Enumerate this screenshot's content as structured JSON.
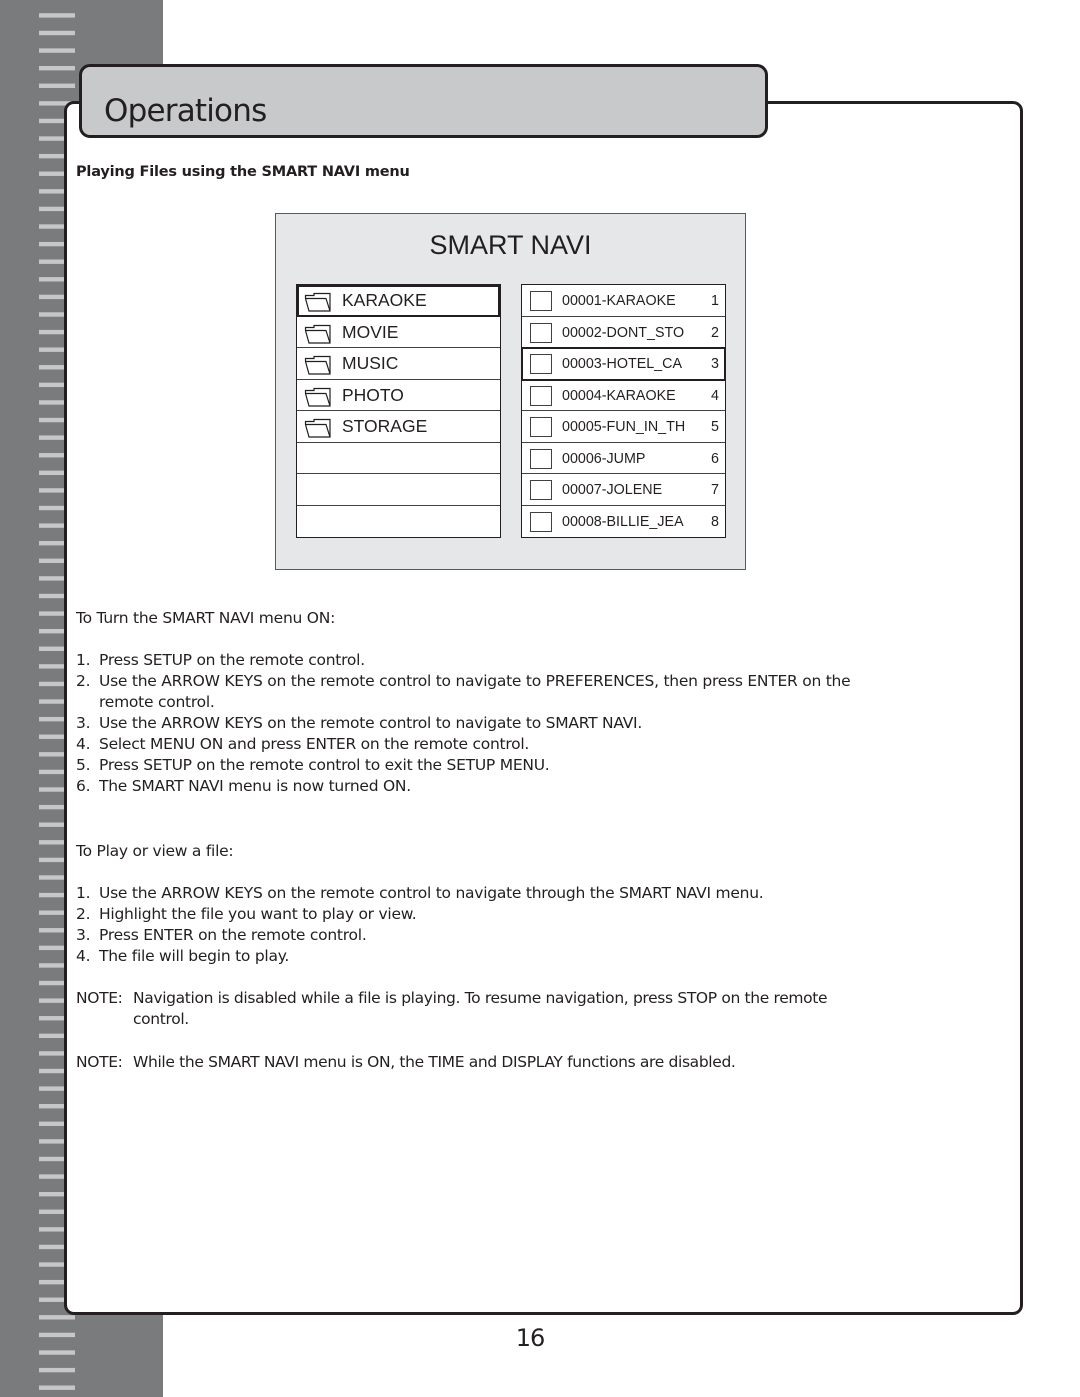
{
  "header": {
    "section_title": "Operations"
  },
  "subheading": "Playing Files using the SMART NAVI menu",
  "smart_navi": {
    "title": "SMART NAVI",
    "categories": [
      {
        "label": "KARAOKE",
        "icon": "folder-icon",
        "selected": true
      },
      {
        "label": "MOVIE",
        "icon": "folder-icon",
        "selected": false
      },
      {
        "label": "MUSIC",
        "icon": "folder-icon",
        "selected": false
      },
      {
        "label": "PHOTO",
        "icon": "folder-icon",
        "selected": false
      },
      {
        "label": "STORAGE",
        "icon": "folder-icon",
        "selected": false
      },
      {
        "label": "",
        "icon": "",
        "selected": false
      },
      {
        "label": "",
        "icon": "",
        "selected": false
      },
      {
        "label": "",
        "icon": "",
        "selected": false
      }
    ],
    "files": [
      {
        "name": "00001-KARAOKE",
        "number": "1",
        "selected": false
      },
      {
        "name": "00002-DONT_STO",
        "number": "2",
        "selected": false
      },
      {
        "name": "00003-HOTEL_CA",
        "number": "3",
        "selected": true
      },
      {
        "name": "00004-KARAOKE",
        "number": "4",
        "selected": false
      },
      {
        "name": "00005-FUN_IN_TH",
        "number": "5",
        "selected": false
      },
      {
        "name": "00006-JUMP",
        "number": "6",
        "selected": false
      },
      {
        "name": "00007-JOLENE",
        "number": "7",
        "selected": false
      },
      {
        "name": "00008-BILLIE_JEA",
        "number": "8",
        "selected": false
      }
    ]
  },
  "turn_on": {
    "heading": "To Turn the SMART NAVI menu ON:",
    "steps": [
      {
        "num": "1.",
        "text": "Press SETUP on the remote control."
      },
      {
        "num": "2.",
        "text": "Use the ARROW KEYS on the remote control to navigate to PREFERENCES, then press ENTER on the remote control."
      },
      {
        "num": "3.",
        "text": "Use the ARROW KEYS on the remote control to navigate to SMART NAVI."
      },
      {
        "num": "4.",
        "text": "Select MENU ON and press ENTER on the remote control."
      },
      {
        "num": "5.",
        "text": "Press SETUP on the remote control to exit the SETUP MENU."
      },
      {
        "num": "6.",
        "text": "The SMART NAVI menu is now turned ON."
      }
    ]
  },
  "play_file": {
    "heading": "To Play or view a file:",
    "steps": [
      {
        "num": "1.",
        "text": "Use the ARROW KEYS on the remote control to navigate through the SMART NAVI menu."
      },
      {
        "num": "2.",
        "text": "Highlight the file you want to play or view."
      },
      {
        "num": "3.",
        "text": "Press ENTER on the remote control."
      },
      {
        "num": "4.",
        "text": "The file will begin to play."
      }
    ]
  },
  "notes": [
    {
      "tag": "NOTE:",
      "text": "Navigation is disabled while a file is playing. To resume navigation, press STOP on the remote control."
    },
    {
      "tag": "NOTE:",
      "text": "While the SMART NAVI menu is ON, the TIME and DISPLAY functions are disabled."
    }
  ],
  "footer": {
    "page_number": "16"
  },
  "colors": {
    "sidebar": "#7a7b7d",
    "sidebar_stripe": "#c6c7c9",
    "title_tab": "#c8c9cb",
    "navi_panel": "#e6e7e8",
    "ink": "#231f20"
  }
}
